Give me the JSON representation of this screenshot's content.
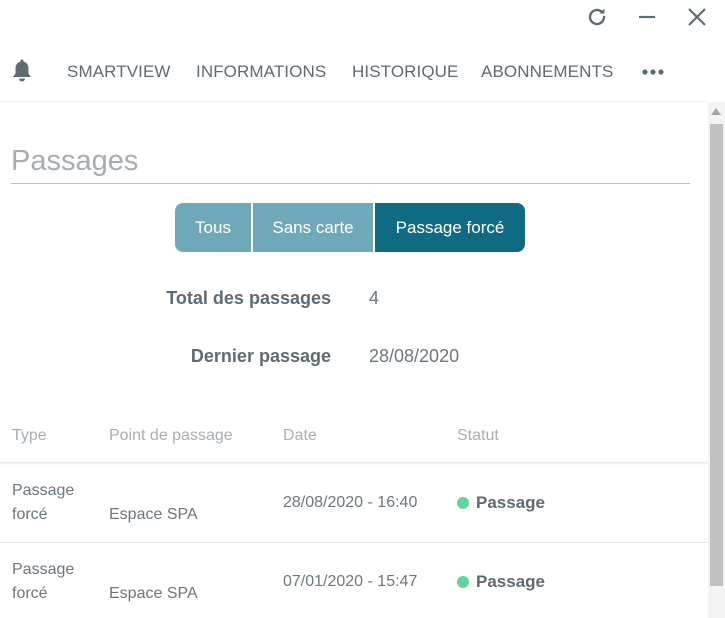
{
  "titlebar": {
    "refresh_icon": "refresh-icon",
    "minimize_icon": "minimize-icon",
    "close_icon": "close-icon"
  },
  "nav": {
    "bell_icon": "bell-icon",
    "items": [
      {
        "label": "SMARTVIEW"
      },
      {
        "label": "INFORMATIONS"
      },
      {
        "label": "HISTORIQUE"
      },
      {
        "label": "ABONNEMENTS"
      }
    ],
    "more_icon": "more-horizontal-icon"
  },
  "section": {
    "title": "Passages"
  },
  "filters": {
    "options": [
      {
        "label": "Tous"
      },
      {
        "label": "Sans carte"
      },
      {
        "label": "Passage forcé"
      }
    ],
    "selected": "Passage forcé"
  },
  "stats": {
    "total_label": "Total des passages",
    "total_value": "4",
    "last_label": "Dernier passage",
    "last_value": "28/08/2020"
  },
  "table": {
    "headers": [
      "Type",
      "Point de passage",
      "Date",
      "Statut"
    ],
    "rows": [
      {
        "type_line1": "Passage",
        "type_line2": "forcé",
        "point": "Espace SPA",
        "date": "28/08/2020 - 16:40",
        "status": "Passage"
      },
      {
        "type_line1": "Passage",
        "type_line2": "forcé",
        "point": "Espace SPA",
        "date": "07/01/2020 - 15:47",
        "status": "Passage"
      }
    ]
  },
  "colors": {
    "accent": "#0f6a84",
    "filter_inactive": "#6fa8b8",
    "status_ok": "#5fd49b",
    "text": "#5f6b73"
  }
}
